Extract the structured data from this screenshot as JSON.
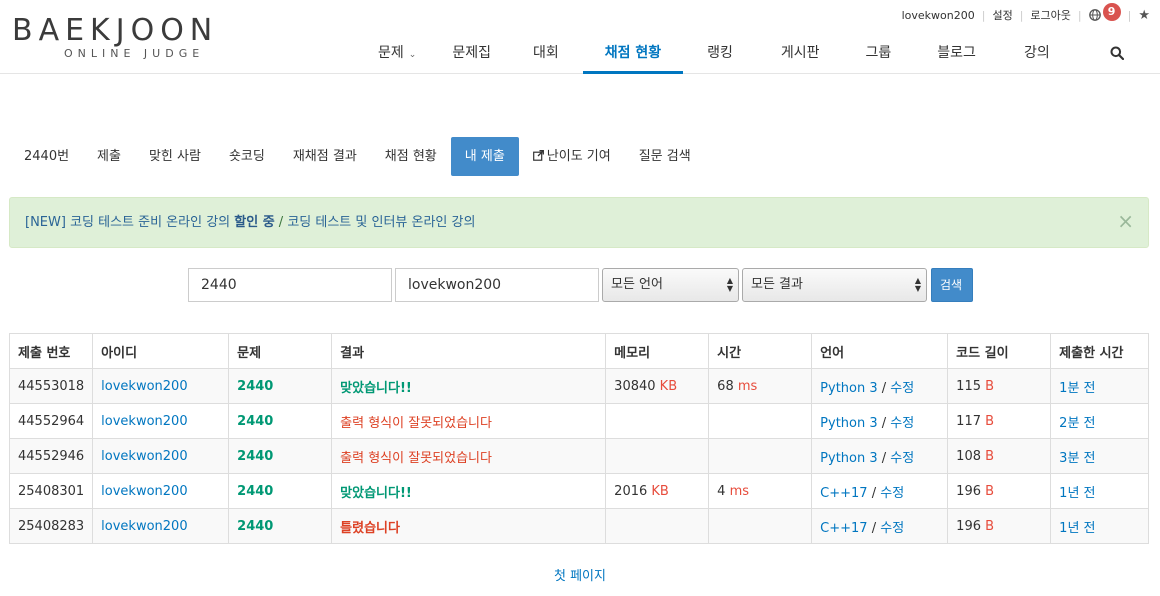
{
  "logo": {
    "main": "BAEKJOON",
    "sub": "ONLINE JUDGE"
  },
  "top_links": {
    "user": "lovekwon200",
    "settings": "설정",
    "logout": "로그아웃",
    "notification_count": "9",
    "star": "★"
  },
  "nav": {
    "items": [
      {
        "label": "문제",
        "has_caret": true
      },
      {
        "label": "문제집"
      },
      {
        "label": "대회"
      },
      {
        "label": "채점 현황",
        "active": true
      },
      {
        "label": "랭킹"
      },
      {
        "label": "게시판"
      },
      {
        "label": "그룹"
      },
      {
        "label": "블로그"
      },
      {
        "label": "강의"
      }
    ]
  },
  "tabs": [
    "2440번",
    "제출",
    "맞힌 사람",
    "숏코딩",
    "재채점 결과",
    "채점 현황",
    "내 제출",
    "난이도 기여",
    "질문 검색"
  ],
  "alert": {
    "part1": "[NEW] 코딩 테스트 준비 온라인 강의 ",
    "part2": "할인 중",
    "part3": " / ",
    "part4": "코딩 테스트 및 인터뷰 온라인 강의",
    "close": "×"
  },
  "search": {
    "problem_id": "2440",
    "user_id": "lovekwon200",
    "language": "모든 언어",
    "result": "모든 결과",
    "button": "검색"
  },
  "table": {
    "headers": [
      "제출 번호",
      "아이디",
      "문제",
      "결과",
      "메모리",
      "시간",
      "언어",
      "코드 길이",
      "제출한 시간"
    ],
    "rows": [
      {
        "id": "44553018",
        "user": "lovekwon200",
        "problem": "2440",
        "result": "맞았습니다!!",
        "status": "ac",
        "memory": "30840",
        "memory_unit": "KB",
        "time": "68",
        "time_unit": "ms",
        "language": "Python 3",
        "edit": "수정",
        "length": "115",
        "length_unit": "B",
        "submitted": "1분 전"
      },
      {
        "id": "44552964",
        "user": "lovekwon200",
        "problem": "2440",
        "result": "출력 형식이 잘못되었습니다",
        "status": "pe",
        "memory": "",
        "memory_unit": "",
        "time": "",
        "time_unit": "",
        "language": "Python 3",
        "edit": "수정",
        "length": "117",
        "length_unit": "B",
        "submitted": "2분 전"
      },
      {
        "id": "44552946",
        "user": "lovekwon200",
        "problem": "2440",
        "result": "출력 형식이 잘못되었습니다",
        "status": "pe",
        "memory": "",
        "memory_unit": "",
        "time": "",
        "time_unit": "",
        "language": "Python 3",
        "edit": "수정",
        "length": "108",
        "length_unit": "B",
        "submitted": "3분 전"
      },
      {
        "id": "25408301",
        "user": "lovekwon200",
        "problem": "2440",
        "result": "맞았습니다!!",
        "status": "ac",
        "memory": "2016",
        "memory_unit": "KB",
        "time": "4",
        "time_unit": "ms",
        "language": "C++17",
        "edit": "수정",
        "length": "196",
        "length_unit": "B",
        "submitted": "1년 전"
      },
      {
        "id": "25408283",
        "user": "lovekwon200",
        "problem": "2440",
        "result": "틀렸습니다",
        "status": "wa",
        "memory": "",
        "memory_unit": "",
        "time": "",
        "time_unit": "",
        "language": "C++17",
        "edit": "수정",
        "length": "196",
        "length_unit": "B",
        "submitted": "1년 전"
      }
    ]
  },
  "pager": {
    "first_page": "첫 페이지"
  },
  "colors": {
    "accent": "#0076c0",
    "active_tab": "#428bca",
    "accepted": "#009874",
    "wrong": "#dd4124",
    "alert_bg": "#dff0d8"
  }
}
